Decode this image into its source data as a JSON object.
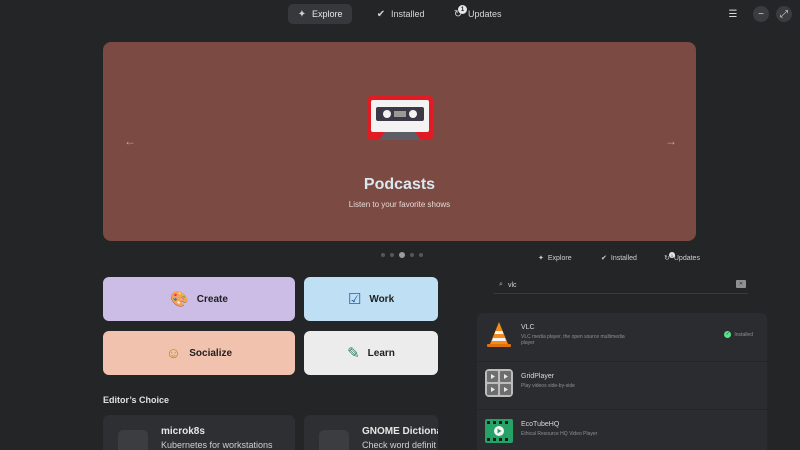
{
  "header": {
    "tabs": [
      {
        "label": "Explore",
        "icon": "compass-icon",
        "active": true
      },
      {
        "label": "Installed",
        "icon": "check-circle-icon",
        "active": false
      },
      {
        "label": "Updates",
        "icon": "refresh-icon",
        "active": false,
        "badge": "1"
      }
    ],
    "controls": {
      "menu": "☰",
      "minimize": "−",
      "maximize": "⤢"
    }
  },
  "banner": {
    "title": "Podcasts",
    "subtitle": "Listen to your favorite shows",
    "background": "#7a4a43",
    "prev_arrow": "←",
    "next_arrow": "→",
    "page_count": 5,
    "active_page": 3
  },
  "categories": [
    {
      "label": "Create",
      "icon": "palette-icon",
      "glyph": "🎨",
      "color": "#cbbde6"
    },
    {
      "label": "Work",
      "icon": "checkbox-icon",
      "glyph": "☑",
      "color": "#bfe0f4"
    },
    {
      "label": "Socialize",
      "icon": "smile-icon",
      "glyph": "☺",
      "color": "#f1c3ae"
    },
    {
      "label": "Learn",
      "icon": "learn-icon",
      "glyph": "✎",
      "color": "#ececec"
    }
  ],
  "editors_choice": {
    "title": "Editor’s Choice",
    "items": [
      {
        "name": "microk8s",
        "description": "Kubernetes for workstations"
      },
      {
        "name": "GNOME Dictionar",
        "description": "Check word definit"
      }
    ]
  },
  "mini_window": {
    "tabs": [
      {
        "label": "Explore",
        "icon": "compass-icon"
      },
      {
        "label": "Installed",
        "icon": "check-circle-icon"
      },
      {
        "label": "Updates",
        "icon": "refresh-icon",
        "badge": "1"
      }
    ],
    "search": {
      "query": "vlc",
      "icon": "search-icon"
    },
    "results": [
      {
        "name": "VLC",
        "description": "VLC media player, the open source multimedia",
        "description2": "player",
        "status": "Installed",
        "icon": "vlc-cone-icon"
      },
      {
        "name": "GridPlayer",
        "description": "Play videos side-by-side",
        "status": "",
        "icon": "grid-player-icon"
      },
      {
        "name": "EcoTubeHQ",
        "description": "Ethical Resource HQ Video Player",
        "status": "",
        "icon": "film-strip-icon"
      }
    ]
  },
  "colors": {
    "background": "#242527",
    "accent_green": "#57e389",
    "vlc_orange": "#f28a1c"
  }
}
